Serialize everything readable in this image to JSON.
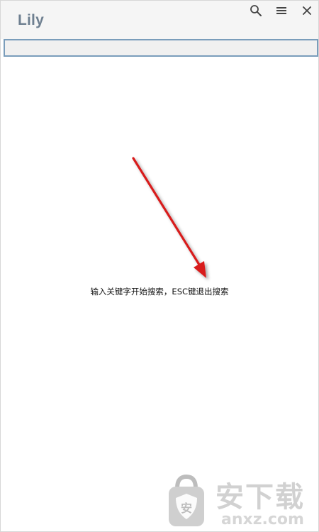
{
  "app": {
    "title": "Lily"
  },
  "toolbar": {
    "search_icon": "search-icon",
    "menu_icon": "menu-icon",
    "close_icon": "close-icon"
  },
  "search": {
    "value": "",
    "placeholder": ""
  },
  "main": {
    "hint": "输入关键字开始搜索，ESC键退出搜索"
  },
  "annotation": {
    "arrow_color": "#d81e1e"
  },
  "watermark": {
    "brand": "安下载",
    "domain": "anxz.com"
  },
  "colors": {
    "title": "#6e7f90",
    "titlebar_bg": "#f5f5f5",
    "search_border": "#7a9dbb",
    "search_bg": "#f0f0f0"
  }
}
